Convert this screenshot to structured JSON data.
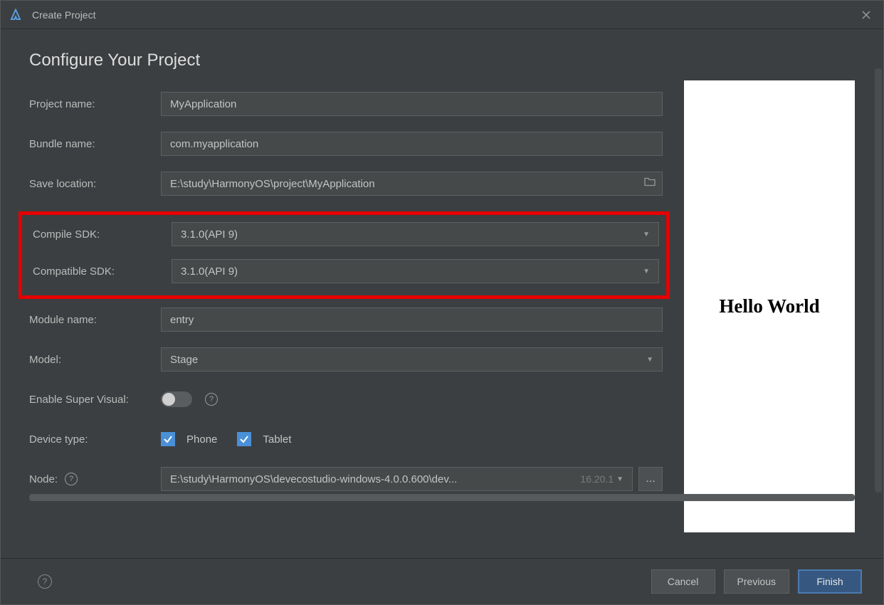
{
  "window": {
    "title": "Create Project"
  },
  "heading": "Configure Your Project",
  "fields": {
    "project_name": {
      "label": "Project name:",
      "value": "MyApplication"
    },
    "bundle_name": {
      "label": "Bundle name:",
      "value": "com.myapplication"
    },
    "save_location": {
      "label": "Save location:",
      "value": "E:\\study\\HarmonyOS\\project\\MyApplication"
    },
    "compile_sdk": {
      "label": "Compile SDK:",
      "value": "3.1.0(API 9)"
    },
    "compatible_sdk": {
      "label": "Compatible SDK:",
      "value": "3.1.0(API 9)"
    },
    "module_name": {
      "label": "Module name:",
      "value": "entry"
    },
    "model": {
      "label": "Model:",
      "value": "Stage"
    },
    "enable_super_visual": {
      "label": "Enable Super Visual:"
    },
    "device_type": {
      "label": "Device type:",
      "opt1": "Phone",
      "opt2": "Tablet"
    },
    "node": {
      "label": "Node:",
      "value": "E:\\study\\HarmonyOS\\devecostudio-windows-4.0.0.600\\dev...",
      "version": "16.20.1",
      "browse": "..."
    }
  },
  "preview": {
    "text": "Hello World"
  },
  "footer": {
    "cancel": "Cancel",
    "previous": "Previous",
    "finish": "Finish"
  }
}
